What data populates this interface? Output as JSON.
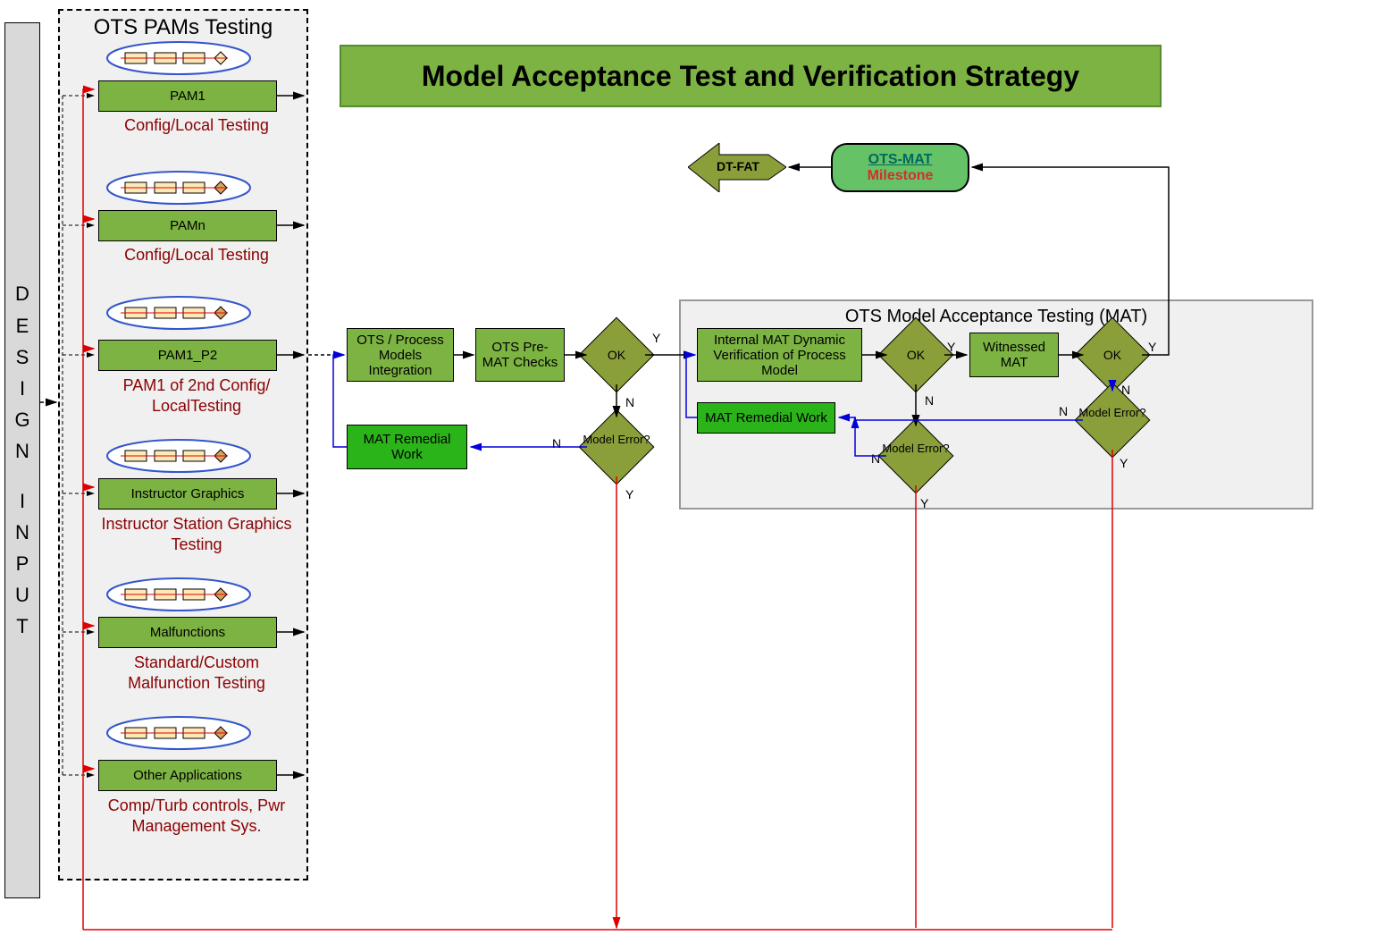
{
  "title": "Model Acceptance Test and Verification Strategy",
  "design_input_label": "DESIGN INPUT",
  "pams_group_title": "OTS PAMs Testing",
  "pams": [
    {
      "label": "PAM1",
      "caption": "Config/Local Testing"
    },
    {
      "label": "PAMn",
      "caption": "Config/Local Testing"
    },
    {
      "label": "PAM1_P2",
      "caption": "PAM1 of 2nd Config/ LocalTesting"
    },
    {
      "label": "Instructor Graphics",
      "caption": "Instructor Station Graphics Testing"
    },
    {
      "label": "Malfunctions",
      "caption": "Standard/Custom Malfunction Testing"
    },
    {
      "label": "Other Applications",
      "caption": "Comp/Turb controls, Pwr Management Sys."
    }
  ],
  "flow": {
    "integration": "OTS / Process Models Integration",
    "premat": "OTS Pre-MAT Checks",
    "ok1": "OK",
    "model_error1": "Model Error?",
    "mat_remedial1": "MAT Remedial Work",
    "mat_group_title": "OTS Model Acceptance Testing (MAT)",
    "internal_mat": "Internal MAT Dynamic Verification of Process Model",
    "ok2": "OK",
    "model_error2": "Model Error?",
    "witnessed_mat": "Witnessed MAT",
    "ok3": "OK",
    "model_error3": "Model Error?",
    "mat_remedial2": "MAT Remedial Work"
  },
  "labels": {
    "Y": "Y",
    "N": "N"
  },
  "milestone": {
    "line1": "OTS-MAT",
    "line2": "Milestone"
  },
  "dt_fat": "DT-FAT"
}
